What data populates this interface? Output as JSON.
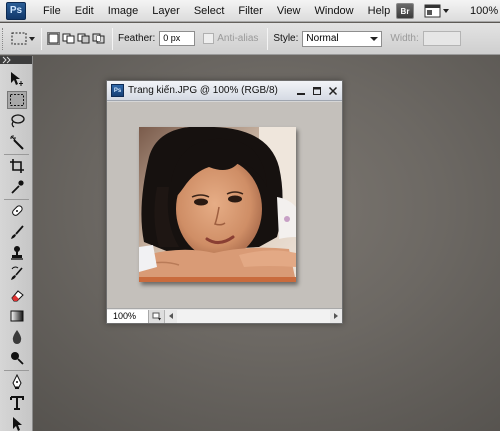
{
  "app": {
    "logo": "Ps",
    "bridge_label": "Br"
  },
  "menu": {
    "items": [
      "File",
      "Edit",
      "Image",
      "Layer",
      "Select",
      "Filter",
      "View",
      "Window",
      "Help"
    ],
    "zoom_readout": "100%"
  },
  "options": {
    "feather_label": "Feather:",
    "feather_value": "0 px",
    "antialias_label": "Anti-alias",
    "style_label": "Style:",
    "style_value": "Normal",
    "width_label": "Width:"
  },
  "document": {
    "title": "Trang kiến.JPG @ 100% (RGB/8)",
    "zoom": "100%",
    "icon_label": "Ps"
  },
  "tools": [
    "move-tool-icon",
    "rectangular-marquee-tool-icon",
    "lasso-tool-icon",
    "magic-wand-tool-icon",
    "crop-tool-icon",
    "eyedropper-tool-icon",
    "spot-healing-brush-tool-icon",
    "brush-tool-icon",
    "clone-stamp-tool-icon",
    "history-brush-tool-icon",
    "eraser-tool-icon",
    "gradient-tool-icon",
    "blur-tool-icon",
    "dodge-tool-icon",
    "pen-tool-icon",
    "type-tool-icon",
    "path-selection-tool-icon"
  ],
  "colors": {
    "workspace": "#6c6863",
    "canvas_bg": "#c4c0bb",
    "menubar": "#e6e6e6"
  }
}
